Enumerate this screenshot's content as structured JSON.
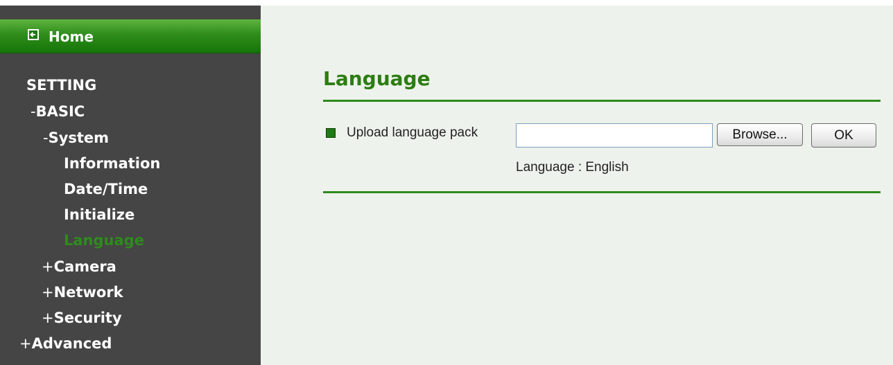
{
  "sidebar": {
    "home_label": "Home",
    "items": [
      {
        "prefix": "",
        "label": "SETTING"
      },
      {
        "prefix": "-",
        "label": "BASIC"
      },
      {
        "prefix": "-",
        "label": "System"
      },
      {
        "prefix": "",
        "label": "Information"
      },
      {
        "prefix": "",
        "label": "Date/Time"
      },
      {
        "prefix": "",
        "label": "Initialize"
      },
      {
        "prefix": "",
        "label": "Language",
        "active": true
      },
      {
        "prefix": "+",
        "label": "Camera"
      },
      {
        "prefix": "+",
        "label": "Network"
      },
      {
        "prefix": "+",
        "label": "Security"
      },
      {
        "prefix": "+",
        "label": "Advanced"
      }
    ]
  },
  "main": {
    "title": "Language",
    "upload_label": "Upload language pack",
    "file_input_value": "",
    "browse_label": "Browse...",
    "ok_label": "OK",
    "language_status": "Language : English"
  },
  "colors": {
    "accent_green": "#2c7d12",
    "sidebar_bg": "#454545",
    "page_bg": "#eef2ec",
    "active_item": "#2f8a1e"
  }
}
